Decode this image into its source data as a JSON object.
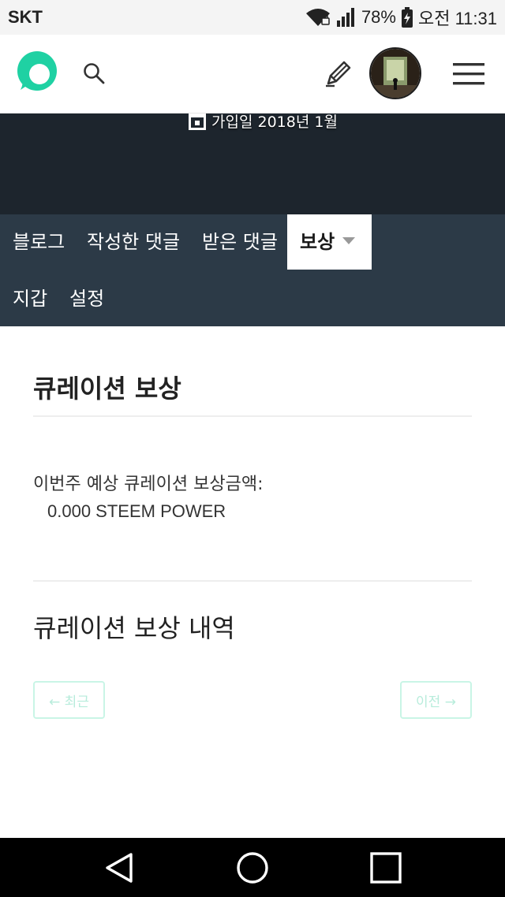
{
  "status_bar": {
    "carrier": "SKT",
    "battery": "78%",
    "time": "오전 11:31"
  },
  "header": {
    "logo_icon": "steemit-logo-icon",
    "search_icon": "search-icon",
    "edit_icon": "pencil-icon",
    "avatar": "avatar",
    "menu_icon": "hamburger-menu-icon",
    "brand_color": "#1fd1a3"
  },
  "profile": {
    "joined": "가입일 2018년 1월"
  },
  "tabs": [
    {
      "label": "블로그"
    },
    {
      "label": "작성한 댓글"
    },
    {
      "label": "받은 댓글"
    },
    {
      "label": "보상",
      "active": true
    },
    {
      "label": "지갑"
    },
    {
      "label": "설정"
    }
  ],
  "main": {
    "title": "큐레이션 보상",
    "estimate_label": "이번주 예상 큐레이션 보상금액:",
    "estimate_value": "0.000 STEEM POWER",
    "history_title": "큐레이션 보상 내역",
    "prev_button": "← 최근",
    "next_button": "이전 →"
  },
  "navbar": {
    "back_icon": "back-triangle-icon",
    "home_icon": "home-circle-icon",
    "recents_icon": "recents-square-icon"
  }
}
